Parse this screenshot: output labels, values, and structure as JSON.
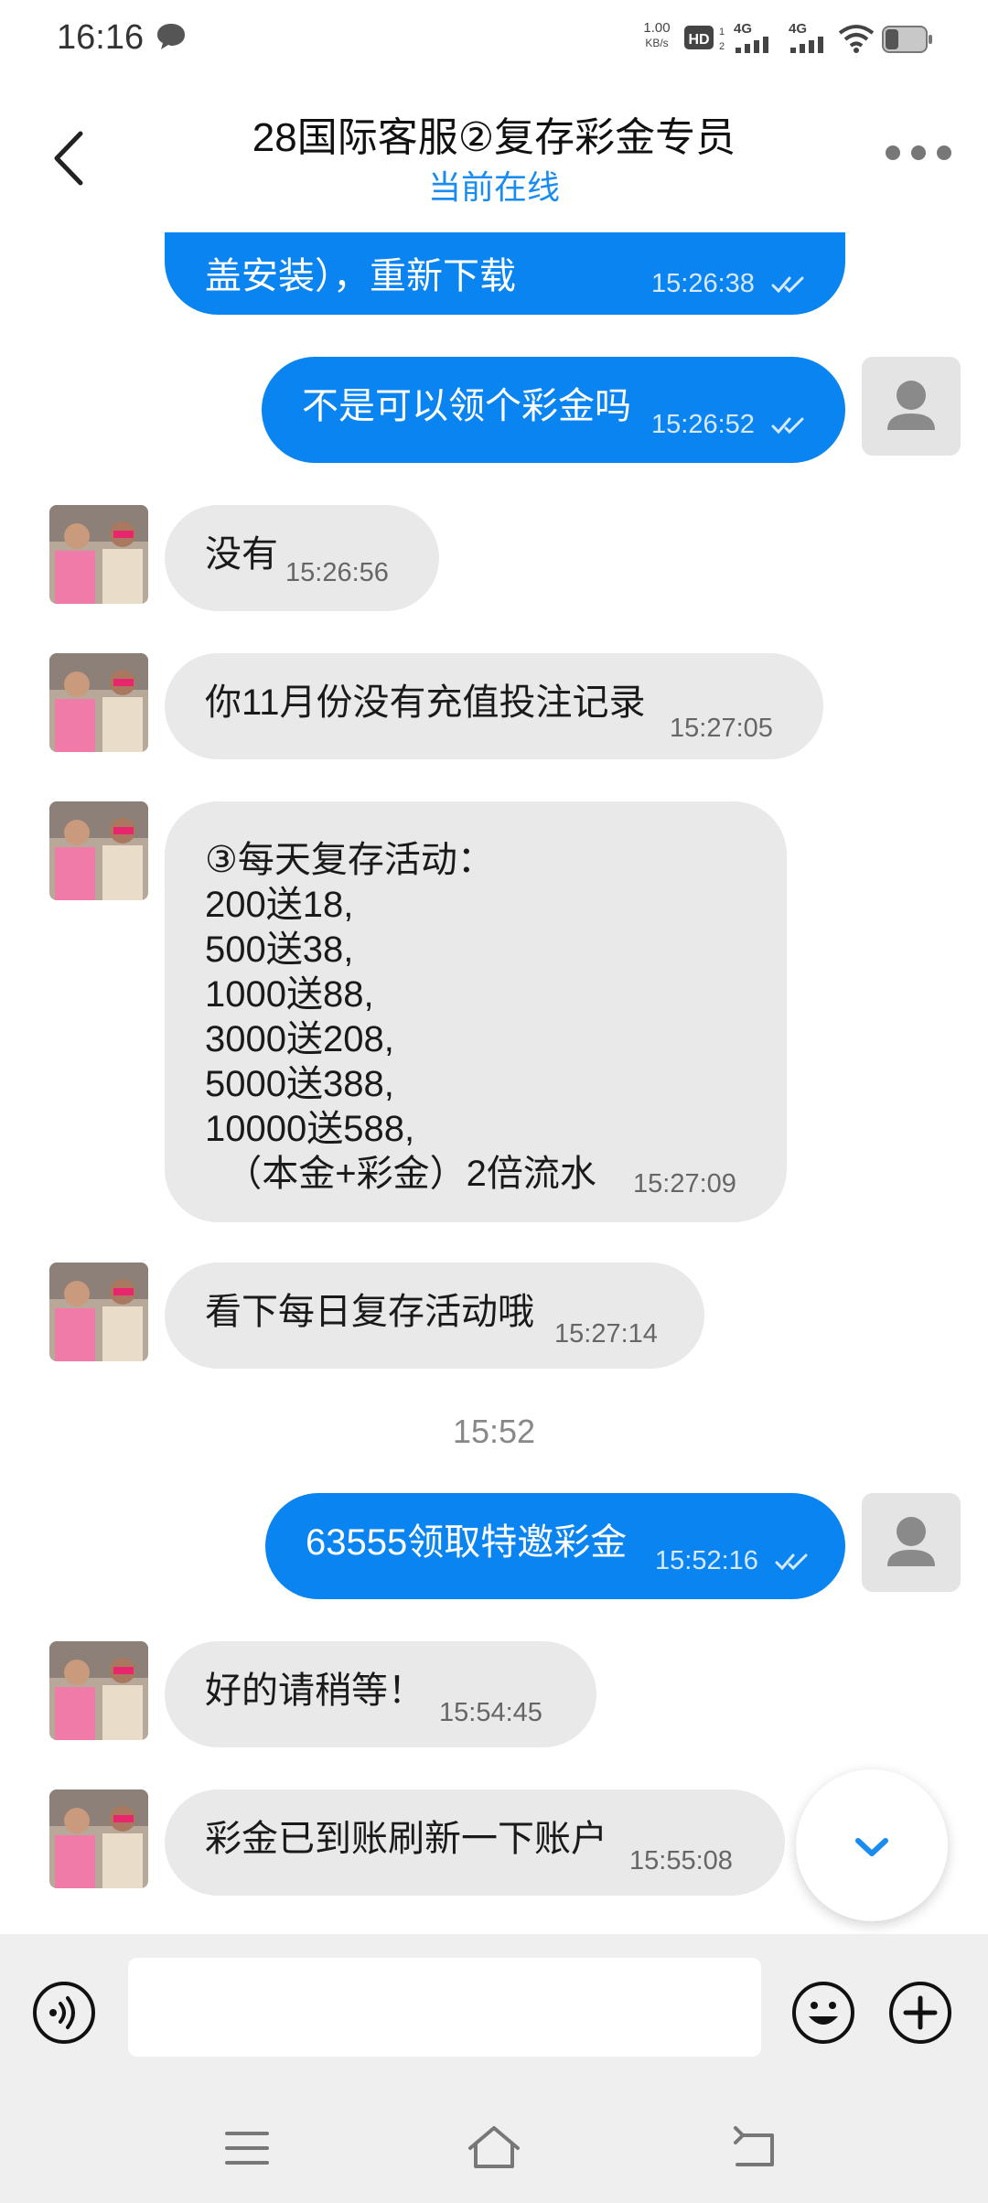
{
  "status_bar": {
    "time": "16:16",
    "net_speed_value": "1.00",
    "net_speed_unit": "KB/s",
    "hd_label": "HD",
    "sim1": "4G",
    "sim2": "4G"
  },
  "header": {
    "title": "28国际客服②复存彩金专员",
    "status": "当前在线"
  },
  "messages": [
    {
      "dir": "out",
      "text": "盖安装），重新下载",
      "time": "15:26:38"
    },
    {
      "dir": "out",
      "text": "不是可以领个彩金吗",
      "time": "15:26:52"
    },
    {
      "dir": "in",
      "text": "没有",
      "time": "15:26:56"
    },
    {
      "dir": "in",
      "text": "你11月份没有充值投注记录",
      "time": "15:27:05"
    },
    {
      "dir": "in",
      "lines": [
        "③每天复存活动：",
        "200送18,",
        "500送38,",
        "1000送88,",
        "3000送208,",
        "5000送388,",
        "10000送588,",
        "  （本金+彩金）2倍流水"
      ],
      "time": "15:27:09"
    },
    {
      "dir": "in",
      "text": "看下每日复存活动哦",
      "time": "15:27:14"
    },
    {
      "dir": "out",
      "text": "63555领取特邀彩金",
      "time": "15:52:16"
    },
    {
      "dir": "in",
      "text": "好的请稍等！",
      "time": "15:54:45"
    },
    {
      "dir": "in",
      "text": "彩金已到账刷新一下账户",
      "time": "15:55:08"
    }
  ],
  "time_divider": "15:52",
  "composer": {
    "placeholder": "",
    "icons": [
      "voice-icon",
      "emoji-icon",
      "plus-icon"
    ]
  },
  "colors": {
    "accent": "#0a84f0",
    "status_online": "#1a8cf0",
    "incoming_bubble": "#e9e9e9",
    "composer_bg": "#efefef"
  }
}
